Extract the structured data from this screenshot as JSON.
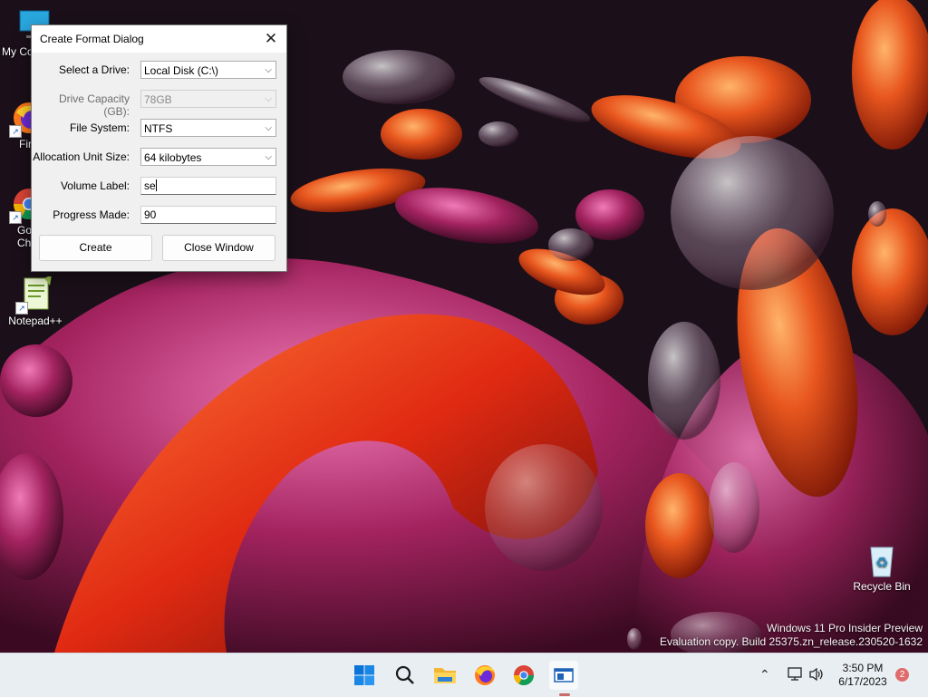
{
  "desktop": {
    "icons": [
      {
        "label": "My Co",
        "name": "my-computer"
      },
      {
        "label": "Fir",
        "name": "firefox"
      },
      {
        "label": "Go Chr",
        "name": "google-chrome"
      },
      {
        "label": "Notepad++",
        "name": "notepad-plus-plus"
      },
      {
        "label": "Recycle Bin",
        "name": "recycle-bin"
      }
    ],
    "watermark": {
      "line1": "Windows 11 Pro Insider Preview",
      "line2": "Evaluation copy. Build 25375.zn_release.230520-1632"
    }
  },
  "dialog": {
    "title": "Create Format Dialog",
    "close_icon": "close-icon",
    "fields": {
      "drive": {
        "label": "Select a Drive:",
        "value": "Local Disk (C:\\)"
      },
      "capacity": {
        "label": "Drive Capacity (GB):",
        "value": "78GB"
      },
      "filesystem": {
        "label": "File System:",
        "value": "NTFS"
      },
      "allocation": {
        "label": "Allocation Unit Size:",
        "value": "64 kilobytes"
      },
      "volume": {
        "label": "Volume Label:",
        "value": "se"
      },
      "progress": {
        "label": "Progress Made:",
        "value": "90"
      }
    },
    "buttons": {
      "create": "Create",
      "close": "Close Window"
    }
  },
  "taskbar": {
    "icons": [
      "windows-start-icon",
      "search-icon",
      "file-explorer-icon",
      "firefox-icon",
      "chrome-icon",
      "active-app-icon"
    ],
    "tray": [
      "chevron-up-icon",
      "network-icon",
      "speaker-icon"
    ],
    "time": "3:50 PM",
    "date": "6/17/2023",
    "notifications": "2"
  },
  "colors": {
    "accent": "#0067c0",
    "taskbar": "#e9eef2",
    "wallpaper_orange": "#e0561a",
    "wallpaper_magenta": "#b0306a"
  }
}
